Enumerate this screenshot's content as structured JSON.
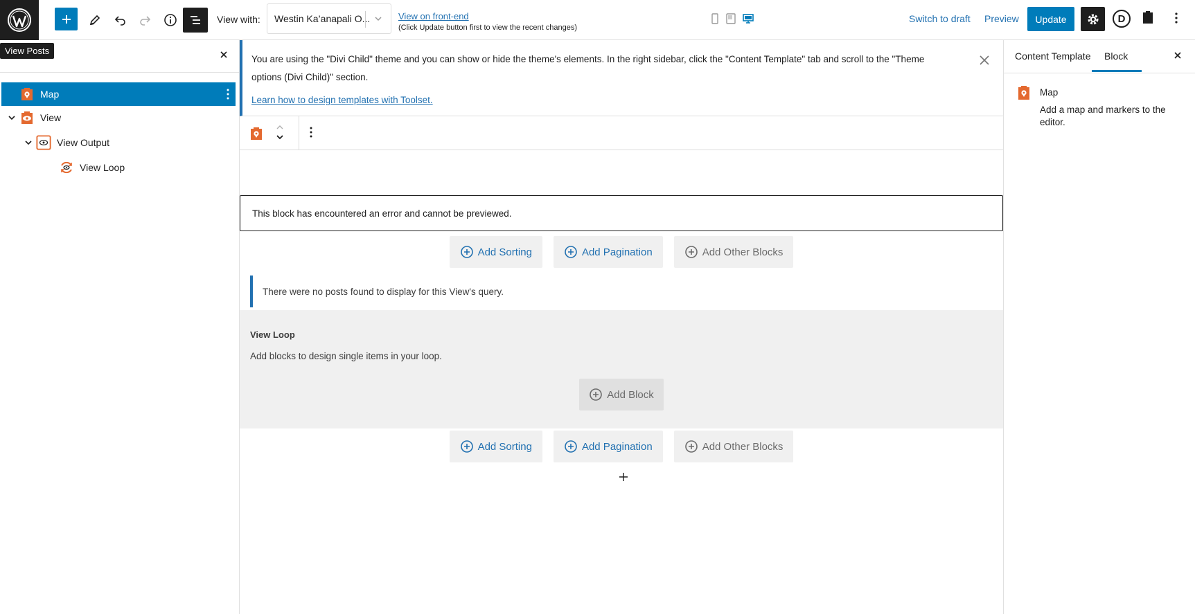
{
  "topbar": {
    "tooltip": "View Posts",
    "view_with_label": "View with:",
    "view_with_value": "Westin Ka’anapali O...",
    "frontend_link": "View on front-end",
    "frontend_note": "(Click Update button first to view the recent changes)",
    "switch_draft": "Switch to draft",
    "preview": "Preview",
    "update": "Update",
    "divi_letter": "D"
  },
  "listview": {
    "items": [
      {
        "label": "Map",
        "icon": "map-marker-icon",
        "selected": true
      },
      {
        "label": "View",
        "icon": "eye-icon",
        "selected": false
      },
      {
        "label": "View Output",
        "icon": "eye-outline-icon",
        "selected": false
      },
      {
        "label": "View Loop",
        "icon": "loop-icon",
        "selected": false
      }
    ]
  },
  "canvas": {
    "notice_text": "You are using the \"Divi Child\" theme and you can show or hide the theme's elements. In the right sidebar, click the \"Content Template\" tab and scroll to the \"Theme options (Divi Child)\" section.",
    "notice_link": "Learn how to design templates with Toolset.",
    "error_text": "This block has encountered an error and cannot be previewed.",
    "add_sorting": "Add Sorting",
    "add_pagination": "Add Pagination",
    "add_other_blocks": "Add Other Blocks",
    "no_posts": "There were no posts found to display for this View's query.",
    "loop_title": "View Loop",
    "loop_sub": "Add blocks to design single items in your loop.",
    "add_block": "Add Block"
  },
  "sidebar": {
    "tab_template": "Content Template",
    "tab_block": "Block",
    "block_title": "Map",
    "block_desc": "Add a map and markers to the editor."
  },
  "colors": {
    "accent": "#007cba",
    "link": "#2271b1",
    "toolset_orange": "#e4692f",
    "dark": "#1e1e1e"
  }
}
